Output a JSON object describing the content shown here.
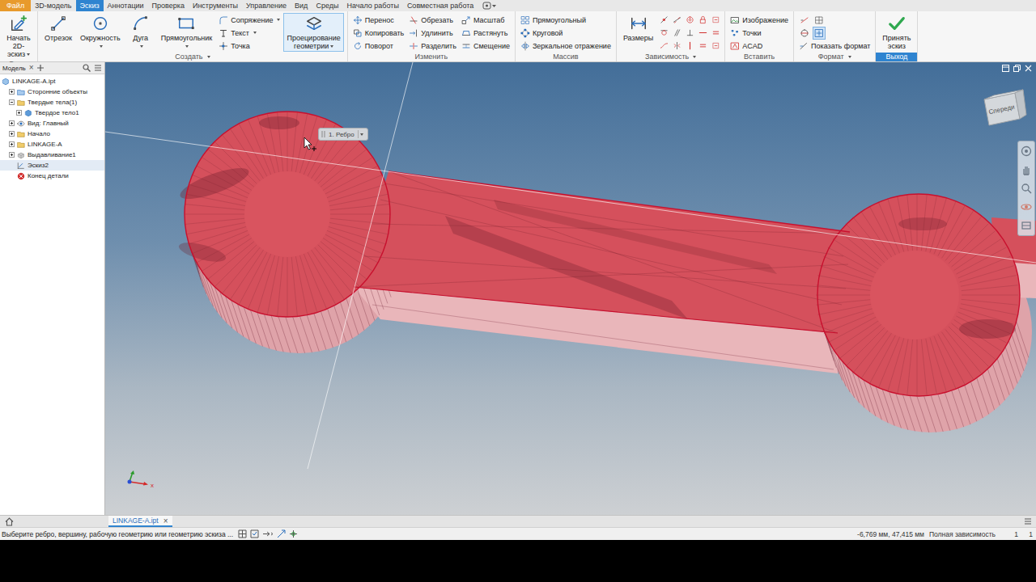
{
  "menu_tabs": [
    {
      "label": "Файл",
      "kind": "file",
      "selected": false
    },
    {
      "label": "3D-модель",
      "kind": "tab",
      "selected": false
    },
    {
      "label": "Эскиз",
      "kind": "tab",
      "selected": true
    },
    {
      "label": "Аннотации",
      "kind": "tab",
      "selected": false
    },
    {
      "label": "Проверка",
      "kind": "tab",
      "selected": false
    },
    {
      "label": "Инструменты",
      "kind": "tab",
      "selected": false
    },
    {
      "label": "Управление",
      "kind": "tab",
      "selected": false
    },
    {
      "label": "Вид",
      "kind": "tab",
      "selected": false
    },
    {
      "label": "Среды",
      "kind": "tab",
      "selected": false
    },
    {
      "label": "Начало работы",
      "kind": "tab",
      "selected": false
    },
    {
      "label": "Совместная работа",
      "kind": "tab",
      "selected": false
    }
  ],
  "ribbon_groups": [
    {
      "label": "Эскиз",
      "dropdown": false,
      "accent": false,
      "blocks": [
        {
          "kind": "large",
          "items": [
            {
              "label": "Начать 2D-эскиз",
              "kind": "sketch",
              "dropdown": true,
              "selected": false
            }
          ]
        }
      ]
    },
    {
      "label": "Создать",
      "dropdown": true,
      "accent": false,
      "blocks": [
        {
          "kind": "large",
          "items": [
            {
              "label": "Отрезок",
              "kind": "line",
              "dropdown": false,
              "selected": false
            },
            {
              "label": "Окружность",
              "kind": "circle",
              "dropdown": true,
              "selected": false
            },
            {
              "label": "Дуга",
              "kind": "arc",
              "dropdown": true,
              "selected": false
            },
            {
              "label": "Прямоугольник",
              "kind": "rect",
              "dropdown": true,
              "selected": false
            }
          ]
        },
        {
          "kind": "column",
          "items": [
            {
              "label": "Сопряжение",
              "kind": "fillet",
              "dropdown": true
            },
            {
              "label": "Текст",
              "kind": "text",
              "dropdown": true
            },
            {
              "label": "Точка",
              "kind": "point",
              "dropdown": false
            }
          ]
        },
        {
          "kind": "large",
          "items": [
            {
              "label": "Проецирование геометрии",
              "kind": "project",
              "dropdown": true,
              "selected": true
            }
          ]
        }
      ]
    },
    {
      "label": "Изменить",
      "dropdown": false,
      "accent": false,
      "blocks": [
        {
          "kind": "column",
          "items": [
            {
              "label": "Перенос",
              "kind": "move",
              "dropdown": false
            },
            {
              "label": "Копировать",
              "kind": "copy",
              "dropdown": false
            },
            {
              "label": "Поворот",
              "kind": "rotate",
              "dropdown": false
            }
          ]
        },
        {
          "kind": "column",
          "items": [
            {
              "label": "Обрезать",
              "kind": "trim",
              "dropdown": false
            },
            {
              "label": "Удлинить",
              "kind": "extend",
              "dropdown": false
            },
            {
              "label": "Разделить",
              "kind": "split",
              "dropdown": false
            }
          ]
        },
        {
          "kind": "column",
          "items": [
            {
              "label": "Масштаб",
              "kind": "scale",
              "dropdown": false
            },
            {
              "label": "Растянуть",
              "kind": "stretch",
              "dropdown": false
            },
            {
              "label": "Смещение",
              "kind": "offset",
              "dropdown": false
            }
          ]
        }
      ]
    },
    {
      "label": "Массив",
      "dropdown": false,
      "accent": false,
      "blocks": [
        {
          "kind": "column",
          "items": [
            {
              "label": "Прямоугольный",
              "kind": "rectpattern",
              "dropdown": false
            },
            {
              "label": "Круговой",
              "kind": "circpattern",
              "dropdown": false
            },
            {
              "label": "Зеркальное отражение",
              "kind": "mirror",
              "dropdown": false
            }
          ]
        }
      ]
    },
    {
      "label": "Зависимость",
      "dropdown": true,
      "accent": false,
      "blocks": [
        {
          "kind": "large",
          "items": [
            {
              "label": "Размеры",
              "kind": "dimension",
              "dropdown": false,
              "selected": false
            }
          ]
        },
        {
          "kind": "constraint-grid",
          "items": []
        }
      ]
    },
    {
      "label": "Вставить",
      "dropdown": false,
      "accent": false,
      "blocks": [
        {
          "kind": "column",
          "items": [
            {
              "label": "Изображение",
              "kind": "image",
              "dropdown": false
            },
            {
              "label": "Точки",
              "kind": "points",
              "dropdown": false
            },
            {
              "label": "ACAD",
              "kind": "acad",
              "dropdown": false
            }
          ]
        }
      ]
    },
    {
      "label": "Формат",
      "dropdown": true,
      "accent": false,
      "blocks": [
        {
          "kind": "format-stack",
          "items": [
            {
              "label": "Показать формат",
              "kind": "showformat",
              "dropdown": false
            }
          ]
        }
      ]
    },
    {
      "label": "Выход",
      "dropdown": false,
      "accent": true,
      "blocks": [
        {
          "kind": "large",
          "items": [
            {
              "label": "Принять эскиз",
              "kind": "accept",
              "dropdown": false,
              "selected": false
            }
          ]
        }
      ]
    }
  ],
  "browser": {
    "title": "Модель",
    "close": "×",
    "items": [
      {
        "label": "LINKAGE-A.ipt",
        "depth": 0,
        "kind": "part",
        "expandable": false,
        "expanded": false,
        "selected": false
      },
      {
        "label": "Сторонние объекты",
        "depth": 1,
        "kind": "folderblue",
        "expandable": true,
        "expanded": false,
        "selected": false
      },
      {
        "label": "Твердые тела(1)",
        "depth": 1,
        "kind": "folder",
        "expandable": true,
        "expanded": true,
        "selected": false
      },
      {
        "label": "Твердое тело1",
        "depth": 2,
        "kind": "body",
        "expandable": true,
        "expanded": false,
        "selected": false
      },
      {
        "label": "Вид: Главный",
        "depth": 1,
        "kind": "view",
        "expandable": true,
        "expanded": false,
        "selected": false
      },
      {
        "label": "Начало",
        "depth": 1,
        "kind": "folder",
        "expandable": true,
        "expanded": false,
        "selected": false
      },
      {
        "label": "LINKAGE-A",
        "depth": 1,
        "kind": "folder",
        "expandable": true,
        "expanded": false,
        "selected": false
      },
      {
        "label": "Выдавливание1",
        "depth": 1,
        "kind": "extrude",
        "expandable": true,
        "expanded": false,
        "selected": false
      },
      {
        "label": "Эскиз2",
        "depth": 1,
        "kind": "sketch2",
        "expandable": false,
        "expanded": false,
        "selected": true
      },
      {
        "label": "Конец детали",
        "depth": 1,
        "kind": "end",
        "expandable": false,
        "expanded": false,
        "selected": false
      }
    ]
  },
  "viewport": {
    "tooltip": "1. Ребро",
    "viewcube": "Спереди",
    "axis_labels": [
      "x"
    ]
  },
  "doc_tabs": [
    {
      "label": "LINKAGE-A.ipt",
      "close": "×",
      "selected": true
    }
  ],
  "status_bar": {
    "prompt": "Выберите ребро, вершину, рабочую геометрию или геометрию эскиза ...",
    "coordinates": "-6,769 мм, 47,415 мм",
    "constraint": "Полная зависимость",
    "counters": [
      "1",
      "1"
    ]
  }
}
